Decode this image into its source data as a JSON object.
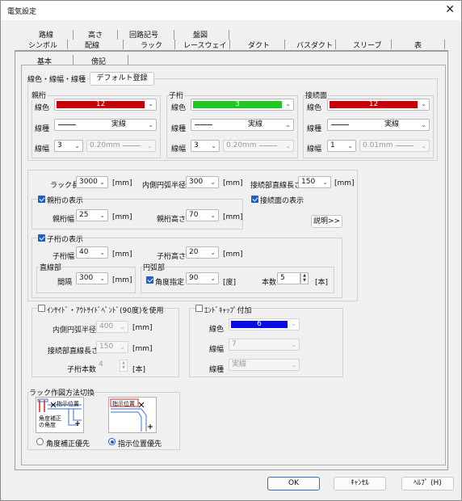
{
  "window": {
    "title": "電気設定"
  },
  "tabs": {
    "row1": [
      "路線",
      "高さ",
      "回路記号",
      "盤図"
    ],
    "row2": [
      "シンボル",
      "配線",
      "ラック",
      "レースウェイ",
      "ダクト",
      "バスダクト",
      "スリーブ",
      "表"
    ]
  },
  "subtabs": [
    "基本",
    "傍記"
  ],
  "line_section": {
    "title": "線色・線幅・線種",
    "default_button": "デフォルト登録",
    "color_label": "線色",
    "type_label": "線種",
    "width_label": "線幅",
    "parent": {
      "title": "親桁",
      "color_value": "12",
      "color_hex": "#c8000a",
      "type_value": "実線",
      "width_num": "3",
      "width_mm": "0.20mm"
    },
    "child": {
      "title": "子桁",
      "color_value": "3",
      "color_hex": "#1ec81e",
      "type_value": "実線",
      "width_num": "3",
      "width_mm": "0.20mm"
    },
    "joint": {
      "title": "接続面",
      "color_value": "12",
      "color_hex": "#c8000a",
      "type_value": "実線",
      "width_num": "1",
      "width_mm": "0.01mm"
    }
  },
  "rack": {
    "length_label": "ラック長さ",
    "length_value": "3000",
    "inner_radius_label": "内側円弧半径",
    "inner_radius_value": "300",
    "joint_straight_label": "接続部直線長さ",
    "joint_straight_value": "150",
    "unit_mm": "[mm]",
    "show_parent_label": "親桁の表示",
    "show_joint_label": "接続面の表示",
    "explain_button": "説明>>",
    "parent_width_label": "親桁幅",
    "parent_width_value": "25",
    "parent_height_label": "親桁高さ",
    "parent_height_value": "70",
    "show_child_label": "子桁の表示",
    "child_width_label": "子桁幅",
    "child_width_value": "40",
    "child_height_label": "子桁高さ",
    "child_height_value": "20",
    "straight_label": "直線部",
    "interval_label": "間隔",
    "interval_value": "300",
    "arc_label": "円弧部",
    "angle_label": "角度指定",
    "angle_value": "90",
    "unit_deg": "[度]",
    "count_label": "本数",
    "count_value": "5",
    "unit_count": "[本]"
  },
  "inside_outside": {
    "checkbox_label": "ｲﾝｻｲﾄﾞ・ｱｳﾄｻｲﾄﾞﾍﾞﾝﾄﾞ(90度)を使用",
    "inner_radius_label": "内側円弧半径",
    "inner_radius_value": "400",
    "joint_straight_label": "接続部直線長さ",
    "joint_straight_value": "150",
    "child_count_label": "子桁本数",
    "child_count_value": "4",
    "unit_mm": "[mm]",
    "unit_count": "[本]"
  },
  "endcap": {
    "checkbox_label": "ｴﾝﾄﾞｷｬｯﾌﾟ付加",
    "color_label": "線色",
    "color_value": "6",
    "color_hex": "#0a0ae6",
    "width_label": "線幅",
    "width_value": "7",
    "type_label": "線種",
    "type_value": "実線"
  },
  "drawing_method": {
    "title": "ラック作図方法切換",
    "img1_top_text": "指示位置",
    "img1_bottom_text": "角度補正の角度",
    "img2_text": "指示位置",
    "option1": "角度補正優先",
    "option2": "指示位置優先"
  },
  "buttons": {
    "ok": "OK",
    "cancel": "ｷｬﾝｾﾙ",
    "help": "ﾍﾙﾌﾟ (H)"
  }
}
